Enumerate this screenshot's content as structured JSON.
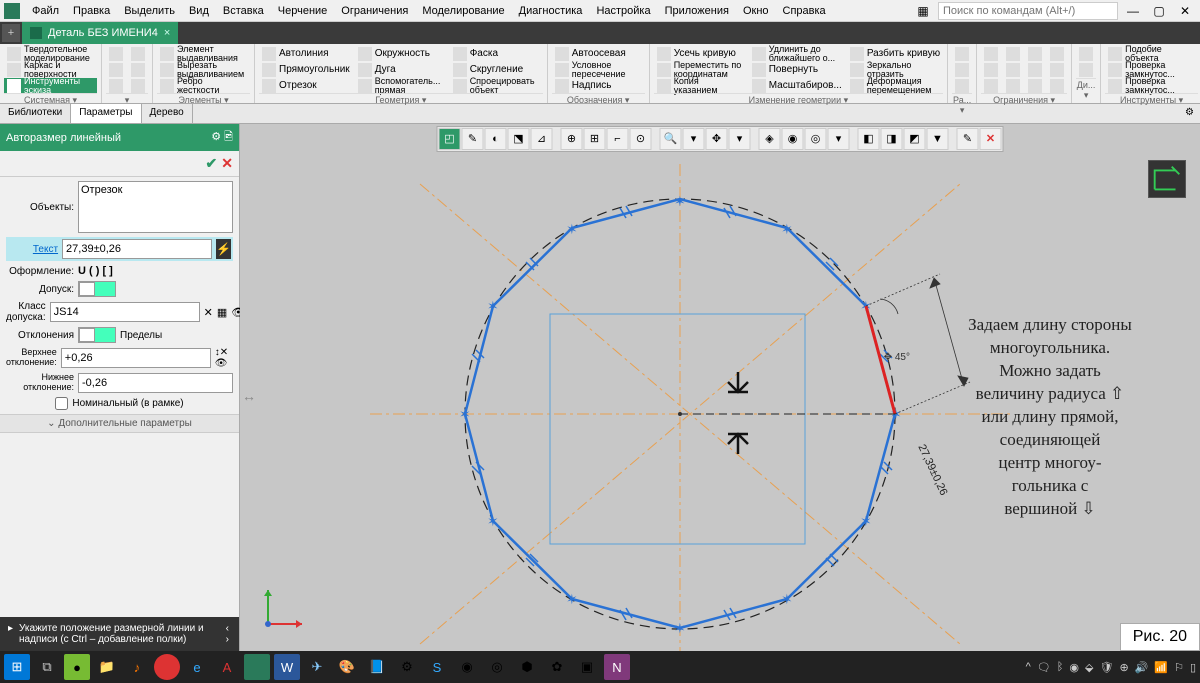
{
  "menu": {
    "items": [
      "Файл",
      "Правка",
      "Выделить",
      "Вид",
      "Вставка",
      "Черчение",
      "Ограничения",
      "Моделирование",
      "Диагностика",
      "Настройка",
      "Приложения",
      "Окно",
      "Справка"
    ],
    "search_placeholder": "Поиск по командам (Alt+/)"
  },
  "tab": {
    "title": "Деталь БЕЗ ИМЕНИ4",
    "close": "×",
    "plus": "+"
  },
  "ribbon": {
    "groups": [
      {
        "title": "Системная",
        "cols": [
          [
            {
              "l": "Твердотельное моделирование",
              "multi": true
            },
            {
              "l": "Каркас и поверхности",
              "multi": true
            },
            {
              "l": "Инструменты эскиза",
              "multi": true,
              "active": true
            }
          ]
        ]
      },
      {
        "title": "",
        "cols": [
          [
            {
              "l": ""
            },
            {
              "l": ""
            },
            {
              "l": ""
            }
          ],
          [
            {
              "l": ""
            },
            {
              "l": ""
            },
            {
              "l": ""
            }
          ]
        ]
      },
      {
        "title": "Элементы",
        "cols": [
          [
            {
              "l": "Элемент выдавливания",
              "multi": true
            },
            {
              "l": "Вырезать выдавливанием",
              "multi": true
            },
            {
              "l": "Ребро жесткости",
              "multi": true
            }
          ]
        ]
      },
      {
        "title": "Геометрия",
        "cols": [
          [
            {
              "l": "Автолиния"
            },
            {
              "l": "Прямоугольник"
            },
            {
              "l": "Отрезок"
            }
          ],
          [
            {
              "l": "Окружность"
            },
            {
              "l": "Дуга"
            },
            {
              "l": "Вспомогатель... прямая",
              "multi": true
            }
          ],
          [
            {
              "l": "Фаска"
            },
            {
              "l": "Скругление"
            },
            {
              "l": "Спроецировать объект",
              "multi": true
            }
          ]
        ]
      },
      {
        "title": "Обозначения",
        "cols": [
          [
            {
              "l": "Автоосевая"
            },
            {
              "l": "Условное пересечение",
              "multi": true
            },
            {
              "l": "Надпись"
            }
          ]
        ]
      },
      {
        "title": "Изменение геометрии",
        "cols": [
          [
            {
              "l": "Усечь кривую"
            },
            {
              "l": "Переместить по координатам",
              "multi": true
            },
            {
              "l": "Копия указанием",
              "multi": true
            }
          ],
          [
            {
              "l": "Удлинить до ближайшего о...",
              "multi": true
            },
            {
              "l": "Повернуть"
            },
            {
              "l": "Масштабиров..."
            }
          ],
          [
            {
              "l": "Разбить кривую"
            },
            {
              "l": "Зеркально отразить",
              "multi": true
            },
            {
              "l": "Деформация перемещением",
              "multi": true
            }
          ]
        ]
      },
      {
        "title": "Ра...",
        "cols": [
          [
            {
              "l": ""
            },
            {
              "l": ""
            },
            {
              "l": ""
            }
          ]
        ]
      },
      {
        "title": "Ограничения",
        "cols": [
          [
            {
              "l": ""
            },
            {
              "l": ""
            },
            {
              "l": ""
            }
          ],
          [
            {
              "l": ""
            },
            {
              "l": ""
            },
            {
              "l": ""
            }
          ],
          [
            {
              "l": ""
            },
            {
              "l": ""
            },
            {
              "l": ""
            }
          ],
          [
            {
              "l": ""
            },
            {
              "l": ""
            },
            {
              "l": ""
            }
          ]
        ]
      },
      {
        "title": "Ди...",
        "cols": [
          [
            {
              "l": ""
            },
            {
              "l": ""
            }
          ]
        ]
      },
      {
        "title": "Инструменты",
        "cols": [
          [
            {
              "l": "Подобие объекта",
              "multi": true
            },
            {
              "l": "Проверка замкнутос...",
              "multi": true
            },
            {
              "l": "Проверка замкнутос...",
              "multi": true
            }
          ]
        ]
      }
    ]
  },
  "sidetabs": {
    "items": [
      "Библиотеки",
      "Параметры",
      "Дерево"
    ],
    "active": 1
  },
  "panel": {
    "title": "Авторазмер линейный",
    "objects_label": "Объекты:",
    "objects_value": "Отрезок",
    "text_label": "Текст",
    "text_value": "27,39±0,26",
    "format_label": "Оформление:",
    "format_value": "U  ( )  [ ]",
    "tolerance_label": "Допуск:",
    "class_label": "Класс допуска:",
    "class_value": "JS14",
    "dev_label": "Отклонения",
    "limits_label": "Пределы",
    "upper_label": "Верхнее отклонение:",
    "upper_value": "+0,26",
    "lower_label": "Нижнее отклонение:",
    "lower_value": "-0,26",
    "nominal_label": "Номинальный (в рамке)",
    "extra": "Дополнительные параметры",
    "hint": "Укажите положение размерной линии и надписи (с Ctrl – добавление полки)"
  },
  "canvas": {
    "dim": "27,39±0,26",
    "angle": "45°",
    "annot_lines": [
      "Задаем длину стороны",
      "многоугольника.",
      "Можно задать",
      "величину радиуса ⇧",
      "или длину прямой,",
      "соединяющей",
      "центр многоу-",
      "гольника   с",
      "вершиной  ⇩"
    ]
  },
  "figure": "Рис. 20"
}
